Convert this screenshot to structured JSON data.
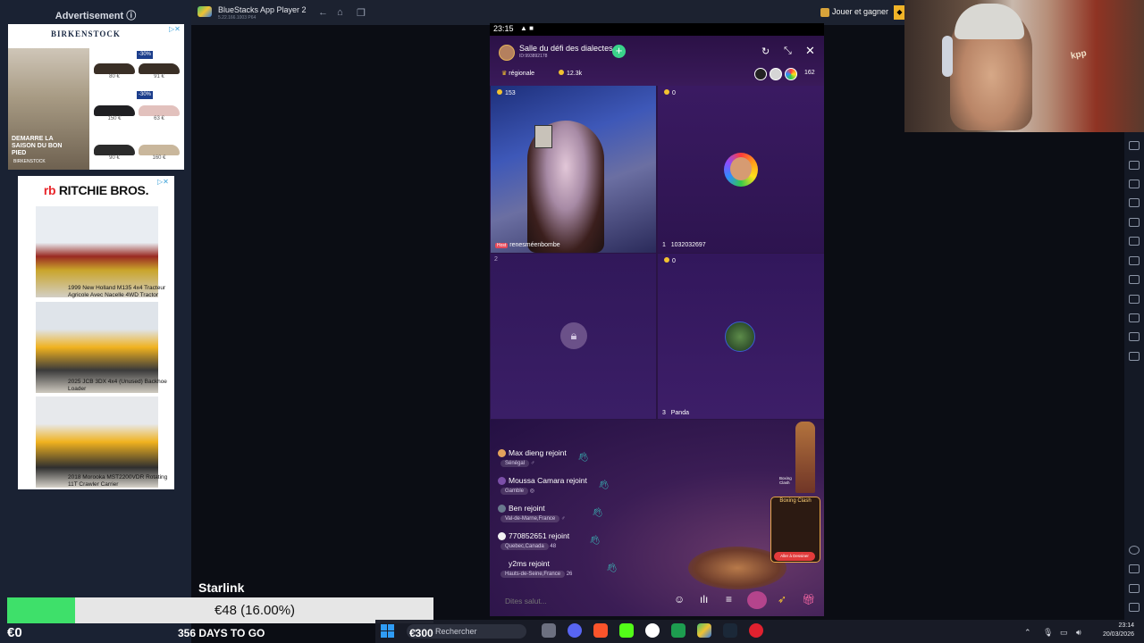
{
  "ads": {
    "header": "Advertisement",
    "birkenstock": {
      "logo": "BIRKENSTOCK",
      "tagline": "DEMARRE LA SAISON DU BON PIED",
      "footer": "BIRKENSTOCK",
      "discounts": [
        "-30%",
        "-30%"
      ],
      "prices": [
        "80 €",
        "91 €",
        "150 €",
        "63 €",
        "90 €",
        "160 €"
      ]
    },
    "ritchie": {
      "logo": "RITCHIE BROS.",
      "items": [
        "1999 New Holland M135 4x4 Tracteur Agricole Avec Nacelle 4WD Tractor",
        "2025 JCB 3DX 4x4 (Unused) Backhoe Loader",
        "2018 Morooka MST2200VDR Rotating 11T Crawler Carrier"
      ]
    }
  },
  "bluestacks": {
    "title": "BlueStacks App Player 2",
    "subtitle": "5.22.166.1003 P64",
    "earn_label": "Jouer et gagner"
  },
  "phone": {
    "status_time": "23:15",
    "status_icons": "▲ ■",
    "room_title": "Salle du défi des dialectes",
    "room_id": "ID:993892178",
    "tag_region": "régionale",
    "popularity": "12.3k",
    "viewer_count": "162",
    "seats": [
      {
        "count": "153",
        "label": "renesméenbombe",
        "badge": "Host"
      },
      {
        "count": "0",
        "label": "1032032697",
        "index": "1"
      },
      {
        "count": "",
        "label": "",
        "index": "2"
      },
      {
        "count": "0",
        "label": "Panda",
        "index": "3"
      }
    ],
    "chat": [
      {
        "name": "Max dieng",
        "action": "rejoint",
        "location": "Sénégal",
        "extra": "♂"
      },
      {
        "name": "Moussa Camara",
        "action": "rejoint",
        "location": "Gamble",
        "extra": "◎"
      },
      {
        "name": "Ben",
        "action": "rejoint",
        "location": "Val-de-Marne,France",
        "extra": "♂"
      },
      {
        "name": "770852651",
        "action": "rejoint",
        "location": "Quebec,Canada",
        "extra": "48"
      },
      {
        "name": "y2ms",
        "action": "rejoint",
        "location": "Hauts-de-Seine,France",
        "extra": "26"
      }
    ],
    "game_card": {
      "title": "Boxing Clash",
      "button": "Aller à Dessiner"
    },
    "input_placeholder": "Dites salut..."
  },
  "overlay": {
    "sponsor": "Starlink",
    "progress_text": "€48 (16.00%)",
    "progress_fraction": 0.16,
    "start_amount": "€0",
    "end_amount": "€300",
    "days_label": "356 DAYS TO GO"
  },
  "taskbar": {
    "search_label": "Rechercher",
    "time": "23:14",
    "date": "20/03/2026"
  },
  "colors": {
    "progress_fill": "#3ee06a",
    "follow": "#3ad38a",
    "windows_accent": "#2f9cf5"
  }
}
